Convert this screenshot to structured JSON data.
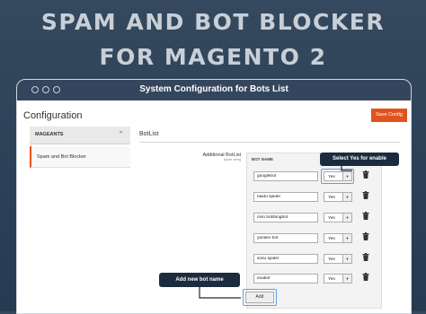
{
  "hero": {
    "line1": "SPAM AND BOT BLOCKER",
    "line2": "FOR MAGENTO 2"
  },
  "window": {
    "title": "System Configuration for Bots List"
  },
  "page": {
    "title": "Configuration",
    "save_label": "Save Config"
  },
  "sidebar": {
    "section_label": "MAGEANTS",
    "items": [
      {
        "label": "Spam and Bot Blocker"
      }
    ]
  },
  "section": {
    "title": "BotList"
  },
  "field": {
    "label": "Additional BotList",
    "scope": "[store view]"
  },
  "grid": {
    "header": "BOT NAME",
    "rows": [
      {
        "bot_name": "googlebot",
        "enabled": "Yes"
      },
      {
        "bot_name": "baidu spider",
        "enabled": "Yes"
      },
      {
        "bot_name": "msn bot/bingbot",
        "enabled": "Yes"
      },
      {
        "bot_name": "yandex bot",
        "enabled": "Yes"
      },
      {
        "bot_name": "sosu spider",
        "enabled": "Yes"
      },
      {
        "bot_name": "exabot",
        "enabled": "Yes"
      }
    ],
    "add_label": "Add"
  },
  "callouts": {
    "enable": "Select Yes for enable",
    "add": "Add new bot name"
  },
  "colors": {
    "accent": "#eb5202",
    "save_button": "#e0531f",
    "callout_bg": "#1c2b3e",
    "highlight": "#5aa0e6",
    "hero_bg": "#34495e"
  },
  "icons": {
    "window_dots": "three-circle-icon",
    "collapse": "chevron-up-icon",
    "select_arrow": "dropdown-arrow-icon",
    "delete": "trash-icon"
  }
}
